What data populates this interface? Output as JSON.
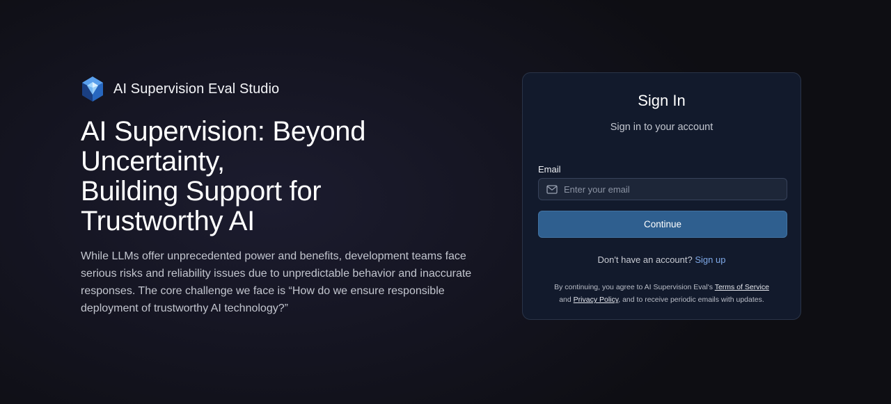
{
  "brand": {
    "name": "AI Supervision Eval Studio",
    "logo_icon": "blue-crystal-cube-icon"
  },
  "hero": {
    "title_lines": [
      "AI Supervision: Beyond",
      "Uncertainty,",
      "Building Support for",
      "Trustworthy AI"
    ],
    "description": "While LLMs offer unprecedented power and benefits, development teams face serious risks and reliability issues due to unpredictable behavior and inaccurate responses. The core challenge we face is “How do we ensure responsible deployment of trustworthy AI technology?”"
  },
  "signin": {
    "title": "Sign In",
    "subtitle": "Sign in to your account",
    "email_label": "Email",
    "email_placeholder": "Enter your email",
    "email_value": "",
    "email_icon": "mail-icon",
    "continue_label": "Continue",
    "no_account_text": "Don't have an account?",
    "signup_label": "Sign up",
    "legal_prefix": "By continuing, you agree to AI Supervision Eval's",
    "terms_label": "Terms of Service",
    "legal_and": "and",
    "privacy_label": "Privacy Policy",
    "legal_suffix": ", and to receive periodic emails with updates."
  },
  "colors": {
    "accent_button": "#2f5f8f",
    "link": "#7fa9e8",
    "card_background": "#121a2c",
    "page_background": "#141420"
  }
}
